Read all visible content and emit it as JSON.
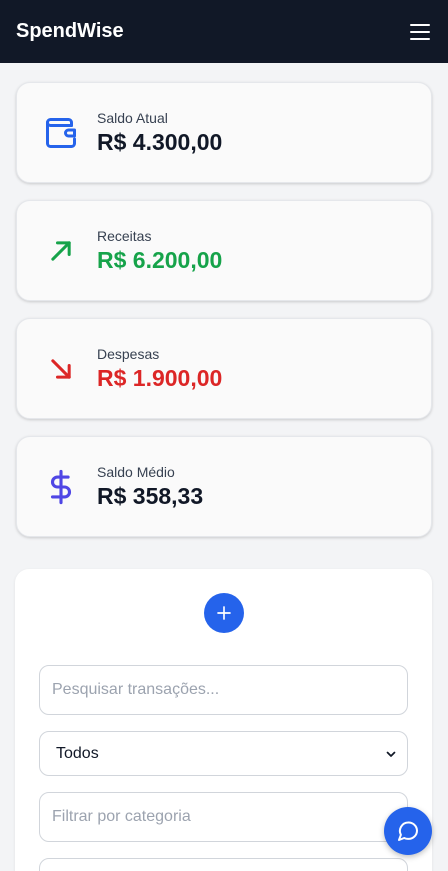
{
  "header": {
    "brand": "SpendWise",
    "menu_icon": "hamburger-menu-icon"
  },
  "summary_cards": [
    {
      "label": "Saldo Atual",
      "value": "R$ 4.300,00",
      "icon": "wallet-icon",
      "color": "#2563eb",
      "value_color": "#111827"
    },
    {
      "label": "Receitas",
      "value": "R$ 6.200,00",
      "icon": "arrow-up-right-icon",
      "color": "#16a34a",
      "value_color": "#16a34a"
    },
    {
      "label": "Despesas",
      "value": "R$ 1.900,00",
      "icon": "arrow-down-right-icon",
      "color": "#dc2626",
      "value_color": "#dc2626"
    },
    {
      "label": "Saldo Médio",
      "value": "R$ 358,33",
      "icon": "dollar-sign-icon",
      "color": "#4f46e5",
      "value_color": "#111827"
    }
  ],
  "filters": {
    "add_icon": "plus-icon",
    "search_placeholder": "Pesquisar transações...",
    "type_selected": "Todos",
    "category_placeholder": "Filtrar por categoria"
  },
  "chat_icon": "chat-bubble-icon"
}
